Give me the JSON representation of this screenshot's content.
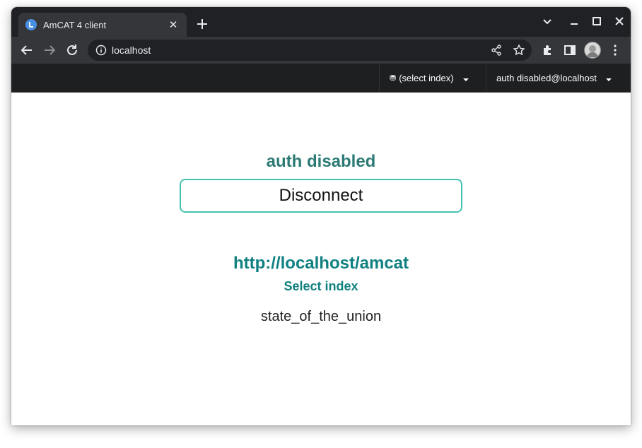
{
  "browser": {
    "tab_title": "AmCAT 4 client",
    "tab_close": "✕",
    "url": "localhost"
  },
  "navbar": {
    "index_selector_label": "(select index)",
    "user_menu_label": "auth disabled@localhost"
  },
  "main": {
    "auth_heading": "auth disabled",
    "disconnect_label": "Disconnect",
    "server_url": "http://localhost/amcat",
    "select_index_heading": "Select index",
    "indices": [
      "state_of_the_union"
    ]
  },
  "colors": {
    "heading": "#2b7a74",
    "accent": "#108080",
    "button_border": "#47c2b1",
    "navbar_bg": "#1d1f21"
  }
}
